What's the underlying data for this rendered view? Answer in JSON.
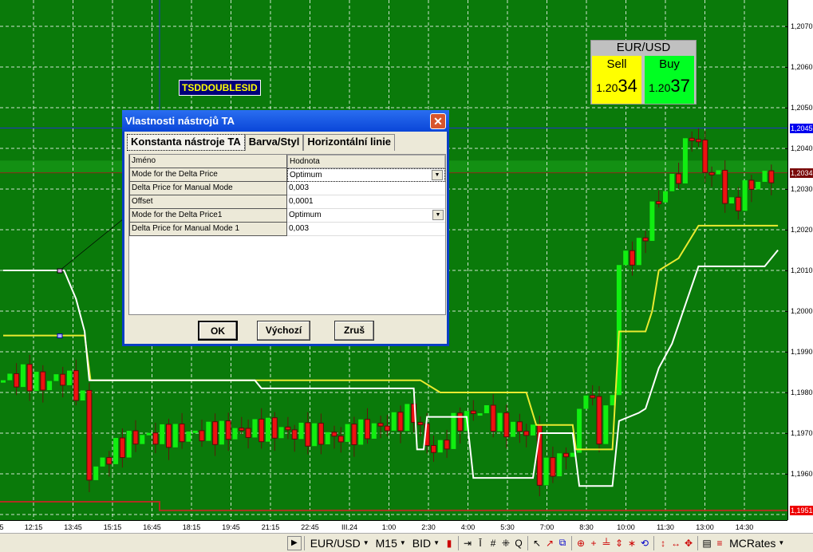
{
  "symbol_box": {
    "title": "EUR/USD",
    "sell_label": "Sell",
    "sell_prefix": "1.20",
    "sell_pips": "34",
    "buy_label": "Buy",
    "buy_prefix": "1.20",
    "buy_pips": "37",
    "sell_color": "#ffff00",
    "buy_color": "#00ff22"
  },
  "indicator_label": "TSDDOUBLESID",
  "dialog": {
    "title": "Vlastnosti nástrojů TA",
    "tabs": [
      "Konstanta nástroje TA",
      "Barva/Styl",
      "Horizontální linie"
    ],
    "header": {
      "name": "Jméno",
      "value": "Hodnota"
    },
    "rows": [
      {
        "name": "Mode for the Delta Price",
        "value": "Optimum",
        "dropdown": true
      },
      {
        "name": "Delta Price for Manual Mode",
        "value": "0,003"
      },
      {
        "name": "Offset",
        "value": "0,0001"
      },
      {
        "name": "Mode for the Delta Price1",
        "value": "Optimum",
        "dropdown": true
      },
      {
        "name": "Delta Price for Manual Mode 1",
        "value": "0,003"
      }
    ],
    "ok": "OK",
    "default": "Výchozí",
    "cancel": "Zruš"
  },
  "price_axis": {
    "labels": [
      "1,2070",
      "1,2060",
      "1,2050",
      "1,2040",
      "1,2030",
      "1,2020",
      "1,2010",
      "1,2000",
      "1,1990",
      "1,1980",
      "1,1970",
      "1,1960"
    ],
    "tags": [
      {
        "text": "1,2045",
        "price": 1.2045,
        "color": "#0000ee"
      },
      {
        "text": "1,2034",
        "price": 1.2034,
        "color": "#7a0a0a"
      },
      {
        "text": "1,1951",
        "price": 1.1951,
        "color": "#ee0000"
      }
    ]
  },
  "time_axis": [
    "5",
    "12:15",
    "13:45",
    "15:15",
    "16:45",
    "18:15",
    "19:45",
    "21:15",
    "22:45",
    "III.24",
    "1:00",
    "2:30",
    "4:00",
    "5:30",
    "7:00",
    "8:30",
    "10:00",
    "11:30",
    "13:00",
    "14:30"
  ],
  "toolbar": {
    "symbol": "EUR/USD",
    "timeframe": "M15",
    "price_type": "BID",
    "source": "MCRates"
  },
  "chart_data": {
    "type": "candlestick",
    "ylim": [
      1.1946,
      1.2076
    ],
    "close_waypoints": [
      [
        0,
        1.1983
      ],
      [
        3,
        1.1984
      ],
      [
        6,
        1.1982
      ],
      [
        9,
        1.1984
      ],
      [
        11,
        1.1981
      ],
      [
        12,
        1.1978
      ],
      [
        13,
        1.196
      ],
      [
        15,
        1.1963
      ],
      [
        17,
        1.1966
      ],
      [
        20,
        1.1969
      ],
      [
        30,
        1.197
      ],
      [
        40,
        1.1971
      ],
      [
        50,
        1.1969
      ],
      [
        58,
        1.1972
      ],
      [
        62,
        1.1975
      ],
      [
        64,
        1.1967
      ],
      [
        66,
        1.1966
      ],
      [
        68,
        1.1972
      ],
      [
        72,
        1.1976
      ],
      [
        75,
        1.1972
      ],
      [
        80,
        1.197
      ],
      [
        81,
        1.196
      ],
      [
        83,
        1.1962
      ],
      [
        86,
        1.1966
      ],
      [
        88,
        1.1982
      ],
      [
        90,
        1.197
      ],
      [
        92,
        1.198
      ],
      [
        93,
        1.2012
      ],
      [
        96,
        1.2015
      ],
      [
        98,
        1.2025
      ],
      [
        100,
        1.203
      ],
      [
        102,
        1.2034
      ],
      [
        104,
        1.2045
      ],
      [
        106,
        1.2035
      ],
      [
        108,
        1.2033
      ],
      [
        110,
        1.2025
      ],
      [
        112,
        1.203
      ],
      [
        114,
        1.2032
      ],
      [
        116,
        1.2034
      ]
    ],
    "yellow_line": [
      [
        0,
        1.1994
      ],
      [
        12.3,
        1.1994
      ],
      [
        13.2,
        1.1983
      ],
      [
        63,
        1.1983
      ],
      [
        66,
        1.198
      ],
      [
        79,
        1.198
      ],
      [
        80.5,
        1.1972
      ],
      [
        86,
        1.1972
      ],
      [
        86.5,
        1.1966
      ],
      [
        92,
        1.1966
      ],
      [
        93,
        1.1995
      ],
      [
        97,
        1.1995
      ],
      [
        98,
        1.2
      ],
      [
        99,
        1.201
      ],
      [
        102,
        1.2013
      ],
      [
        105,
        1.2021
      ],
      [
        117,
        1.2021
      ]
    ],
    "white_line": [
      [
        0,
        1.201
      ],
      [
        9.2,
        1.201
      ],
      [
        11,
        1.2003
      ],
      [
        12.3,
        1.1995
      ],
      [
        13,
        1.1983
      ],
      [
        38,
        1.1983
      ],
      [
        39,
        1.1981
      ],
      [
        62,
        1.1981
      ],
      [
        62.5,
        1.1966
      ],
      [
        63.5,
        1.1966
      ],
      [
        64,
        1.1974
      ],
      [
        70,
        1.1974
      ],
      [
        71,
        1.1959
      ],
      [
        80,
        1.1959
      ],
      [
        81,
        1.197
      ],
      [
        86,
        1.197
      ],
      [
        87,
        1.1957
      ],
      [
        92,
        1.1957
      ],
      [
        93,
        1.1973
      ],
      [
        96,
        1.1975
      ],
      [
        97,
        1.1976
      ],
      [
        99,
        1.1986
      ],
      [
        101,
        1.1992
      ],
      [
        105,
        1.2011
      ],
      [
        115,
        1.2011
      ],
      [
        117,
        1.2015
      ]
    ],
    "hlines": {
      "ask": 1.2045,
      "bid": 1.2034,
      "low": 1.1951
    }
  }
}
